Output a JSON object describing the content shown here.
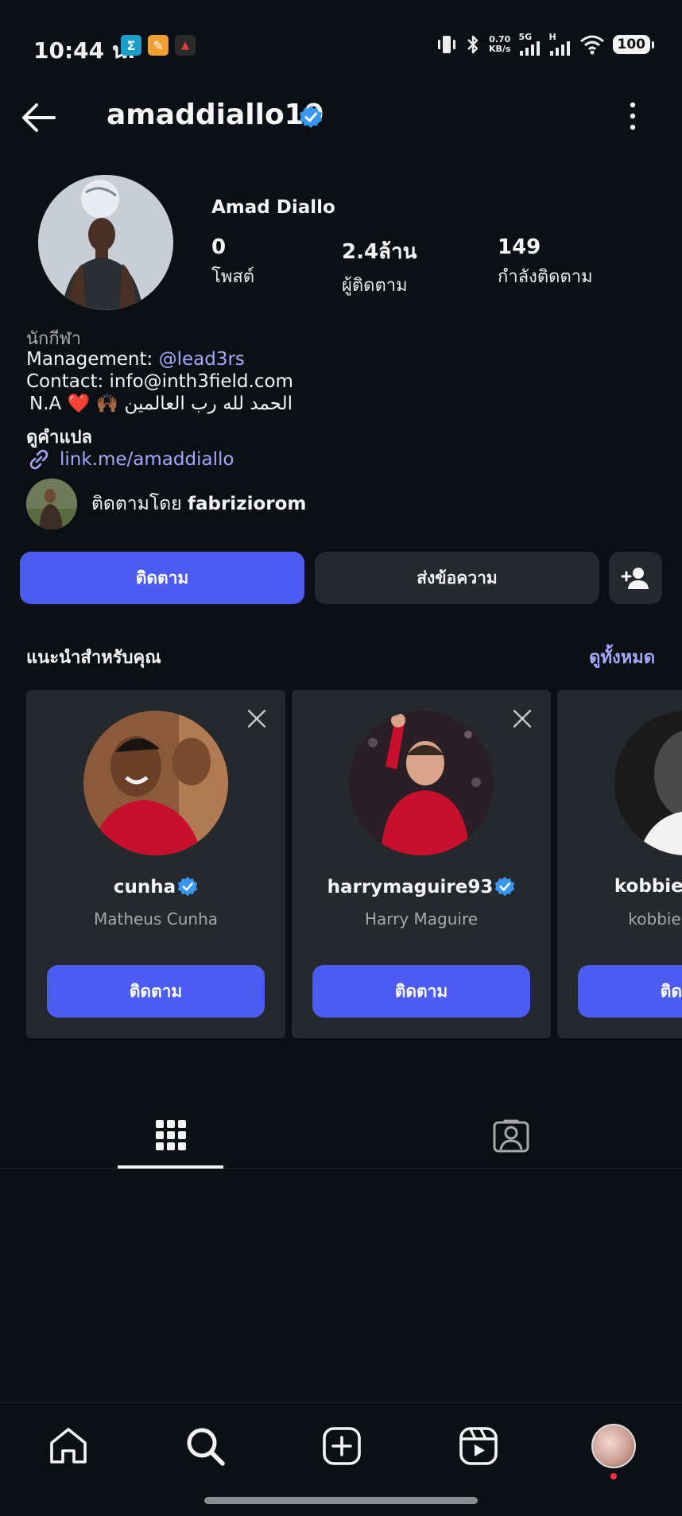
{
  "status_bar": {
    "time": "10:44 น.",
    "net_speed_value": "0.70",
    "net_speed_unit": "KB/s",
    "network_5g": "5G",
    "network_h": "H",
    "battery": "100",
    "app_icons": [
      {
        "name": "sigma-app-icon",
        "glyph": "Σ",
        "color": "#1aa0c8"
      },
      {
        "name": "orange-app-icon",
        "glyph": "✎",
        "color": "#f0a030"
      },
      {
        "name": "red-triangle-app-icon",
        "glyph": "▲",
        "color": "#e04040"
      }
    ]
  },
  "header": {
    "username": "amaddiallo19"
  },
  "profile": {
    "full_name": "Amad Diallo",
    "stats": [
      {
        "value": "0",
        "label": "โพสต์"
      },
      {
        "value": "2.4ล้าน",
        "label": "ผู้ติดตาม"
      },
      {
        "value": "149",
        "label": "กำลังติดตาม"
      }
    ],
    "category": "นักกีฬา",
    "bio": {
      "management_prefix": "Management: ",
      "management_handle": "@lead3rs",
      "contact": "Contact: info@inth3field.com",
      "line3": "N.A ❤️ 🙌🏾 الحمد لله رب العالمين"
    },
    "translate_label": "ดูคำแปล",
    "link": "link.me/amaddiallo",
    "followed_by_prefix": "ติดตามโดย ",
    "followed_by_name": "fabriziorom"
  },
  "actions": {
    "follow": "ติดตาม",
    "message": "ส่งข้อความ"
  },
  "suggestions": {
    "title": "แนะนำสำหรับคุณ",
    "see_all": "ดูทั้งหมด",
    "cards": [
      {
        "username": "cunha",
        "name": "Matheus Cunha",
        "button": "ติดตาม"
      },
      {
        "username": "harrymaguire93",
        "name": "Harry Maguire",
        "button": "ติดตาม"
      },
      {
        "username": "kobbiemainoo",
        "name": "kobbie mainoo",
        "button": "ติดตาม"
      }
    ]
  },
  "colors": {
    "background": "#0c1014",
    "accent": "#4d5cf0",
    "link": "#a4a9ff",
    "verified": "#3897f0",
    "card": "#25292e"
  }
}
